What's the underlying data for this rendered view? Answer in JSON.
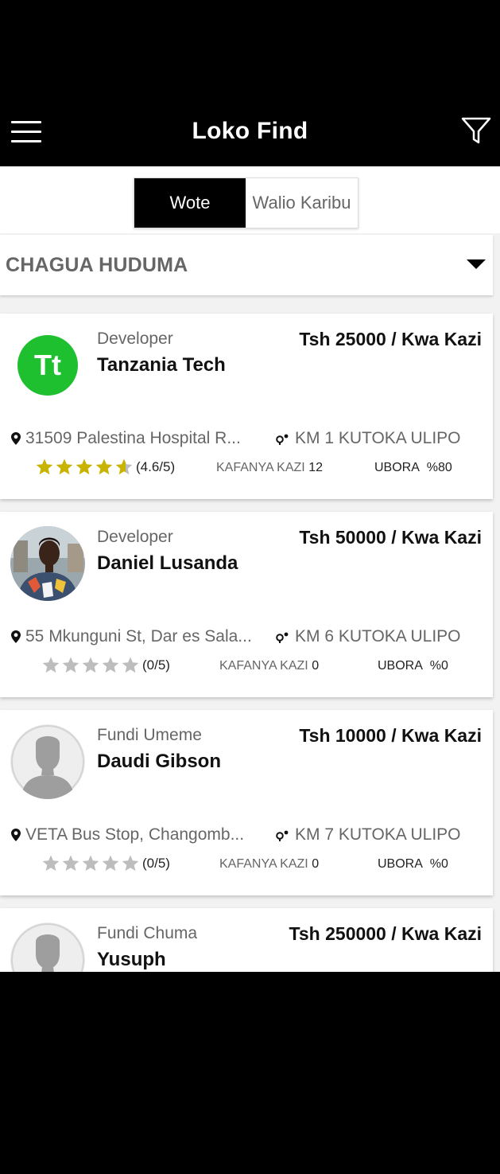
{
  "app": {
    "title": "Loko Find",
    "menu_icon": "hamburger-menu-icon",
    "filter_icon": "funnel-filter-icon"
  },
  "tabs": [
    {
      "label": "Wote",
      "selected": true
    },
    {
      "label": "Walio Karibu",
      "selected": false
    }
  ],
  "service_select": {
    "label": "CHAGUA HUDUMA",
    "icon": "dropdown-triangle-icon"
  },
  "labels": {
    "jobs_prefix": "KAFANYA KAZI",
    "quality_prefix": "UBORA"
  },
  "colors": {
    "accent": "#000000",
    "star_filled": "#c8b400",
    "star_empty": "#bdbdbd",
    "logo_green": "#1fc030"
  },
  "providers": [
    {
      "category": "Developer",
      "name": "Tanzania Tech",
      "price": "Tsh 25000  / Kwa Kazi",
      "address": "31509 Palestina Hospital R...",
      "distance": "KM 1 KUTOKA ULIPO",
      "rating": 4.6,
      "rating_text": "(4.6/5)",
      "jobs": "12",
      "quality": "%80",
      "avatar": "tt-logo",
      "avatar_text": "Tt"
    },
    {
      "category": "Developer",
      "name": "Daniel Lusanda",
      "price": "Tsh 50000  / Kwa Kazi",
      "address": "55 Mkunguni St, Dar es Sala...",
      "distance": "KM 6 KUTOKA ULIPO",
      "rating": 0,
      "rating_text": "(0/5)",
      "jobs": "0",
      "quality": "%0",
      "avatar": "photo"
    },
    {
      "category": "Fundi Umeme",
      "name": "Daudi Gibson",
      "price": "Tsh 10000  / Kwa Kazi",
      "address": "VETA Bus Stop, Changomb...",
      "distance": "KM 7 KUTOKA ULIPO",
      "rating": 0,
      "rating_text": "(0/5)",
      "jobs": "0",
      "quality": "%0",
      "avatar": "default-person"
    },
    {
      "category": "Fundi Chuma",
      "name": "Yusuph",
      "price": "Tsh 250000  / Kwa Kazi",
      "avatar": "default-person"
    }
  ]
}
